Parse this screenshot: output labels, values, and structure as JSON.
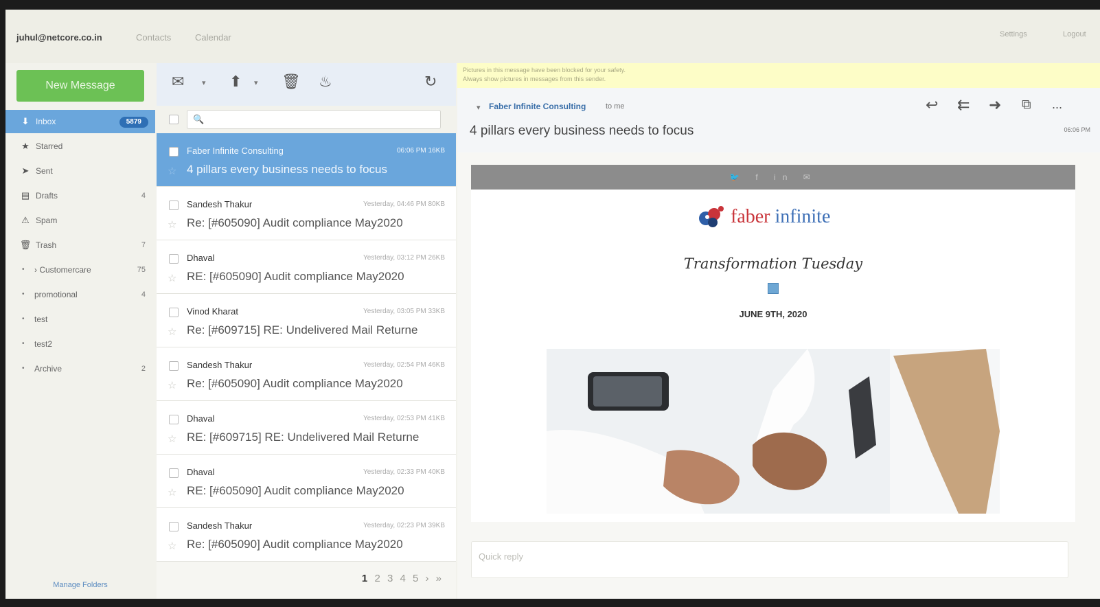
{
  "topbar": {
    "user": "juhul@netcore.co.in",
    "nav": [
      "Contacts",
      "Calendar"
    ],
    "settings": "Settings",
    "logout": "Logout"
  },
  "sidebar": {
    "new_message": "New Message",
    "folders": [
      {
        "label": "Inbox",
        "count": "5879",
        "icon": "inbox-icon"
      },
      {
        "label": "Starred",
        "count": "",
        "icon": "star-icon"
      },
      {
        "label": "Sent",
        "count": "",
        "icon": "send-icon"
      },
      {
        "label": "Drafts",
        "count": "4",
        "icon": "draft-icon"
      },
      {
        "label": "Spam",
        "count": "",
        "icon": "spam-icon"
      },
      {
        "label": "Trash",
        "count": "7",
        "icon": "trash-icon"
      }
    ],
    "subfolders": [
      {
        "label": "› Customercare",
        "count": "75"
      },
      {
        "label": "promotional",
        "count": "4"
      },
      {
        "label": "test",
        "count": ""
      },
      {
        "label": "test2",
        "count": ""
      },
      {
        "label": "Archive",
        "count": "2"
      }
    ],
    "manage_folders": "Manage Folders"
  },
  "list": {
    "search_placeholder": "",
    "messages": [
      {
        "from": "Faber Infinite Consulting",
        "meta": "06:06 PM  16KB",
        "subject": "4 pillars every business needs to focus",
        "selected": true
      },
      {
        "from": "Sandesh Thakur",
        "meta": "Yesterday, 04:46 PM  80KB",
        "subject": "Re: [#605090] Audit compliance May2020",
        "selected": false
      },
      {
        "from": "Dhaval",
        "meta": "Yesterday, 03:12 PM  26KB",
        "subject": "RE: [#605090] Audit compliance May2020",
        "selected": false
      },
      {
        "from": "Vinod Kharat",
        "meta": "Yesterday, 03:05 PM  33KB",
        "subject": "Re: [#609715] RE: Undelivered Mail Returne",
        "selected": false
      },
      {
        "from": "Sandesh Thakur",
        "meta": "Yesterday, 02:54 PM  46KB",
        "subject": "Re: [#605090] Audit compliance May2020",
        "selected": false
      },
      {
        "from": "Dhaval",
        "meta": "Yesterday, 02:53 PM  41KB",
        "subject": "RE: [#609715] RE: Undelivered Mail Returne",
        "selected": false
      },
      {
        "from": "Dhaval",
        "meta": "Yesterday, 02:33 PM  40KB",
        "subject": "RE: [#605090] Audit compliance May2020",
        "selected": false
      },
      {
        "from": "Sandesh Thakur",
        "meta": "Yesterday, 02:23 PM  39KB",
        "subject": "Re: [#605090] Audit compliance May2020",
        "selected": false
      }
    ],
    "pager": {
      "current": "1",
      "pages": "2 3 4 5",
      "next": "›",
      "last": "»"
    }
  },
  "reader": {
    "notice_line1": "Pictures in this message have been blocked for your safety.",
    "notice_line2": "Always show pictures in messages from this sender.",
    "from": "Faber Infinite Consulting",
    "to": "to me",
    "subject": "4 pillars every business needs to focus",
    "time": "06:06 PM",
    "more": "...",
    "social": "🐦 f in ✉",
    "logo_a": "faber",
    "logo_b": " infinite",
    "tagline": "Transformation Tuesday",
    "date": "JUNE 9TH, 2020",
    "quick_reply": "Quick reply"
  }
}
